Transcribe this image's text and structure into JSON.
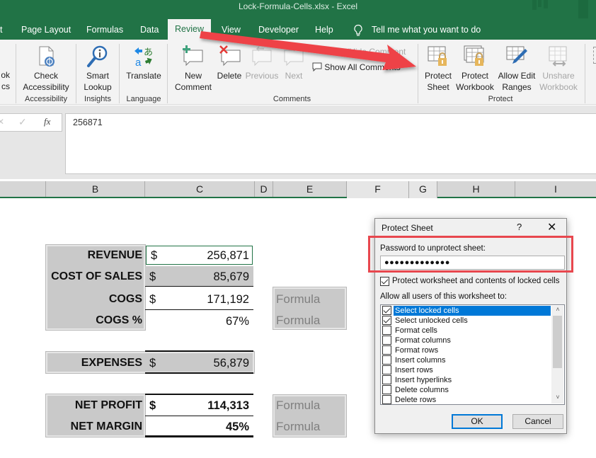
{
  "window": {
    "title": "Lock-Formula-Cells.xlsx  -  Excel"
  },
  "tabs": [
    {
      "label": "t"
    },
    {
      "label": "Page Layout"
    },
    {
      "label": "Formulas"
    },
    {
      "label": "Data"
    },
    {
      "label": "Review",
      "active": true
    },
    {
      "label": "View"
    },
    {
      "label": "Developer"
    },
    {
      "label": "Help"
    }
  ],
  "tell_me": {
    "placeholder": "Tell me what you want to do",
    "icon": "lightbulb-icon"
  },
  "ribbon": {
    "partial_left": {
      "line1": "ok",
      "line2": "cs"
    },
    "groups": [
      {
        "label": "Accessibility",
        "buttons": [
          {
            "line1": "Check",
            "line2": "Accessibility",
            "icon": "check-accessibility-icon"
          }
        ]
      },
      {
        "label": "Insights",
        "buttons": [
          {
            "line1": "Smart",
            "line2": "Lookup",
            "icon": "smart-lookup-icon"
          }
        ]
      },
      {
        "label": "Language",
        "buttons": [
          {
            "line1": "Translate",
            "line2": "",
            "icon": "translate-icon"
          }
        ]
      },
      {
        "label": "Comments",
        "buttons": [
          {
            "line1": "New",
            "line2": "Comment",
            "icon": "new-comment-icon"
          },
          {
            "line1": "Delete",
            "line2": "",
            "icon": "delete-comment-icon"
          },
          {
            "line1": "Previous",
            "line2": "",
            "icon": "previous-comment-icon",
            "disabled": true
          },
          {
            "line1": "Next",
            "line2": "",
            "icon": "next-comment-icon",
            "disabled": true
          }
        ],
        "small_buttons": [
          {
            "label": "Show/Hide Comment",
            "disabled": true
          },
          {
            "label": "Show All Comments"
          }
        ]
      },
      {
        "label": "Protect",
        "buttons": [
          {
            "line1": "Protect",
            "line2": "Sheet",
            "icon": "protect-sheet-icon"
          },
          {
            "line1": "Protect",
            "line2": "Workbook",
            "icon": "protect-workbook-icon"
          },
          {
            "line1": "Allow Edit",
            "line2": "Ranges",
            "icon": "allow-edit-ranges-icon"
          },
          {
            "line1": "Unshare",
            "line2": "Workbook",
            "icon": "unshare-workbook-icon",
            "disabled": true
          }
        ]
      }
    ]
  },
  "formula_bar": {
    "cancel": "✕",
    "enter": "✓",
    "fx": "fx",
    "value": "256871"
  },
  "columns": [
    "B",
    "C",
    "D",
    "E",
    "F",
    "G",
    "H",
    "I"
  ],
  "sheet": {
    "block1": [
      {
        "label": "REVENUE",
        "currency": "$",
        "value": "256,871"
      },
      {
        "label": "COST OF SALES",
        "currency": "$",
        "value": "85,679"
      },
      {
        "label": "COGS",
        "currency": "$",
        "value": "171,192"
      },
      {
        "label": "COGS %",
        "currency": "",
        "value": "67%"
      }
    ],
    "block2": [
      {
        "label": "EXPENSES",
        "currency": "$",
        "value": "56,879"
      }
    ],
    "block3": [
      {
        "label": "NET PROFIT",
        "currency": "$",
        "value": "114,313"
      },
      {
        "label": "NET MARGIN",
        "currency": "",
        "value": "45%"
      }
    ],
    "formula_notes": [
      "Formula",
      "Formula",
      "Formula",
      "Formula"
    ]
  },
  "dialog": {
    "title": "Protect Sheet",
    "help": "?",
    "close": "✕",
    "password_label": "Password to unprotect sheet:",
    "password_value": "●●●●●●●●●●●●●",
    "protect_checkbox": {
      "label": "Protect worksheet and contents of locked cells",
      "checked": true
    },
    "allow_label": "Allow all users of this worksheet to:",
    "permissions": [
      {
        "label": "Select locked cells",
        "checked": true,
        "selected": true
      },
      {
        "label": "Select unlocked cells",
        "checked": true
      },
      {
        "label": "Format cells",
        "checked": false
      },
      {
        "label": "Format columns",
        "checked": false
      },
      {
        "label": "Format rows",
        "checked": false
      },
      {
        "label": "Insert columns",
        "checked": false
      },
      {
        "label": "Insert rows",
        "checked": false
      },
      {
        "label": "Insert hyperlinks",
        "checked": false
      },
      {
        "label": "Delete columns",
        "checked": false
      },
      {
        "label": "Delete rows",
        "checked": false
      }
    ],
    "ok": "OK",
    "cancel": "Cancel"
  },
  "colors": {
    "excel_green": "#217346",
    "highlight_red": "#e8474e",
    "selection_blue": "#0078d7"
  }
}
